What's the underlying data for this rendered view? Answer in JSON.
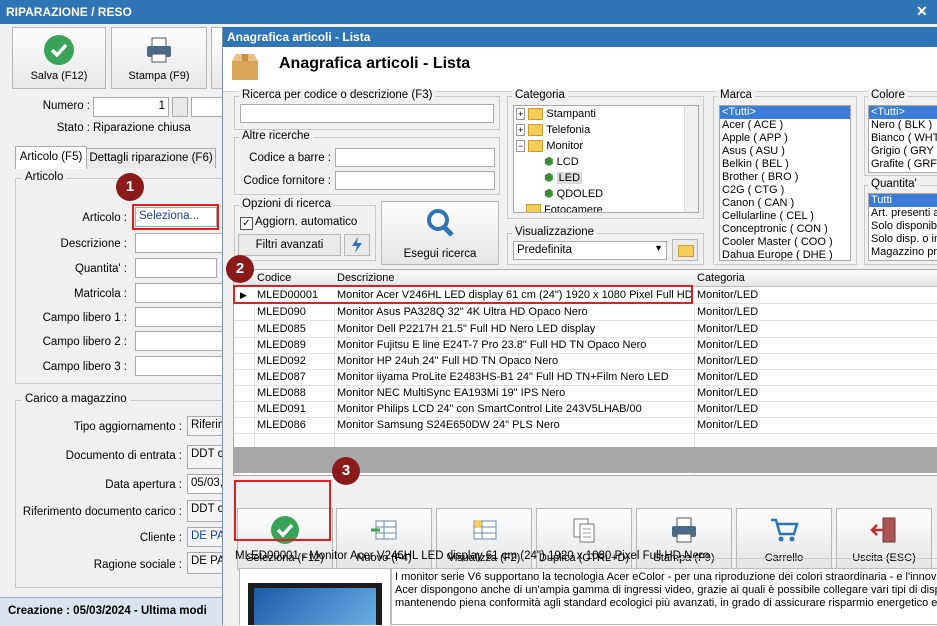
{
  "back_window": {
    "title": "RIPARAZIONE / RESO",
    "toolbar": {
      "save_label": "Salva (F12)",
      "print_label": "Stampa (F9)"
    },
    "numero_label": "Numero :",
    "numero_value": "1",
    "stato_label": "Stato :",
    "stato_value": "Riparazione chiusa",
    "tabs": [
      "Articolo (F5)",
      "Dettagli riparazione (F6)"
    ],
    "articolo_group": "Articolo",
    "fields": {
      "articolo_label": "Articolo :",
      "articolo_value": "Seleziona...",
      "descrizione_label": "Descrizione :",
      "quantita_label": "Quantita' :",
      "matricola_label": "Matricola :",
      "campo1_label": "Campo libero 1 :",
      "campo2_label": "Campo libero 2 :",
      "campo3_label": "Campo libero 3 :"
    },
    "carico_group": "Carico a magazzino",
    "carico": {
      "tipo_label": "Tipo aggiornamento :",
      "tipo_value": "Riferim",
      "doc_label": "Documento di entrata :",
      "doc_value": "DDT ca",
      "data_label": "Data apertura :",
      "data_value": "05/03,",
      "rif_label": "Riferimento documento carico :",
      "rif_value": "DDT ca",
      "cliente_label": "Cliente :",
      "cliente_value": "DE PA",
      "ragione_label": "Ragione sociale :",
      "ragione_value": "DE PA"
    },
    "status": "Creazione : 05/03/2024 - Ultima modi"
  },
  "dialog": {
    "title": "Anagrafica articoli  - Lista",
    "heading": "Anagrafica articoli  - Lista",
    "search_group": "Ricerca per codice o descrizione (F3)",
    "other_group": "Altre ricerche",
    "barcode_label": "Codice a barre :",
    "supplier_label": "Codice fornitore :",
    "options_group": "Opzioni di ricerca",
    "auto_update_label": "Aggiorn. automatico",
    "advanced_filters": "Filtri avanzati",
    "run_search": "Esegui ricerca",
    "categoria_group": "Categoria",
    "tree": [
      "Stampanti",
      "Telefonia",
      "Monitor",
      "LCD",
      "LED",
      "QDOLED",
      "Fotocamere"
    ],
    "visual_group": "Visualizzazione",
    "visual_value": "Predefinita",
    "marca_group": "Marca",
    "marche": [
      "<Tutti>",
      "Acer ( ACE )",
      "Apple ( APP )",
      "Asus ( ASU )",
      "Belkin ( BEL )",
      "Brother ( BRO )",
      "C2G ( CTG )",
      "Canon ( CAN )",
      "Cellularline ( CEL )",
      "Conceptronic ( CON )",
      "Cooler Master ( COO )",
      "Dahua Europe ( DHE )"
    ],
    "colore_group": "Colore",
    "colori": [
      "<Tutti>",
      "Nero ( BLK )",
      "Bianco ( WHT )",
      "Grigio ( GRY )",
      "Grafite ( GRF )"
    ],
    "quantita_group": "Quantita'",
    "quantita": [
      "Tutti",
      "Art. presenti a",
      "Solo disponibil",
      "Solo disp. o in",
      "Magazzino prin"
    ],
    "grid_headers": [
      "Codice",
      "Descrizione",
      "Categoria"
    ],
    "rows": [
      {
        "code": "MLED00001",
        "desc": "Monitor Acer V246HL LED display 61 cm (24\") 1920 x 1080 Pixel Full HD ...",
        "cat": "Monitor/LED"
      },
      {
        "code": "MLED090",
        "desc": "Monitor Asus PA328Q 32\" 4K Ultra HD Opaco Nero",
        "cat": "Monitor/LED"
      },
      {
        "code": "MLED085",
        "desc": "Monitor Dell P2217H 21.5\" Full HD Nero LED display",
        "cat": "Monitor/LED"
      },
      {
        "code": "MLED089",
        "desc": "Monitor Fujitsu E line E24T-7 Pro 23.8\" Full HD TN Opaco Nero",
        "cat": "Monitor/LED"
      },
      {
        "code": "MLED092",
        "desc": "Monitor HP 24uh 24\" Full HD TN Opaco Nero",
        "cat": "Monitor/LED"
      },
      {
        "code": "MLED087",
        "desc": "Monitor iiyama ProLite E2483HS-B1 24\" Full HD TN+Film Nero LED",
        "cat": "Monitor/LED"
      },
      {
        "code": "MLED088",
        "desc": "Monitor NEC MultiSync EA193Mi 19\" IPS Nero",
        "cat": "Monitor/LED"
      },
      {
        "code": "MLED091",
        "desc": "Monitor Philips LCD 24\" con SmartControl Lite 243V5LHAB/00",
        "cat": "Monitor/LED"
      },
      {
        "code": "MLED086",
        "desc": "Monitor Samsung S24E650DW 24\" PLS Nero",
        "cat": "Monitor/LED"
      }
    ],
    "buttons": [
      "Seleziona (F12)",
      "Nuovo (F4)",
      "Visualizza (F2)",
      "Duplica (CTRL+D)",
      "Stampa (F9)",
      "Carrello",
      "Uscita (ESC)"
    ],
    "detail_title": "MLED00001 - Monitor Acer V246HL LED display 61 cm (24\") 1920 x 1080 Pixel Full HD Nero",
    "detail_lines": [
      "I monitor serie V6 supportano la tecnologia Acer eColor - per una riproduzione dei colori straordinaria - e l'innovati",
      "Acer dispongono anche di un'ampia gamma di ingressi video, grazie ai quali è possibile collegare vari tipi di dispositi",
      "mantenendo piena conformità agli standard ecologici più avanzati, in grado di assicurare risparmio energetico e ri"
    ]
  },
  "annotations": [
    "1",
    "2",
    "3"
  ],
  "colors": {
    "accent": "#2f75b5",
    "badge": "#8b1b1b",
    "highlight": "#e02020",
    "selection": "#3a7dd6"
  }
}
